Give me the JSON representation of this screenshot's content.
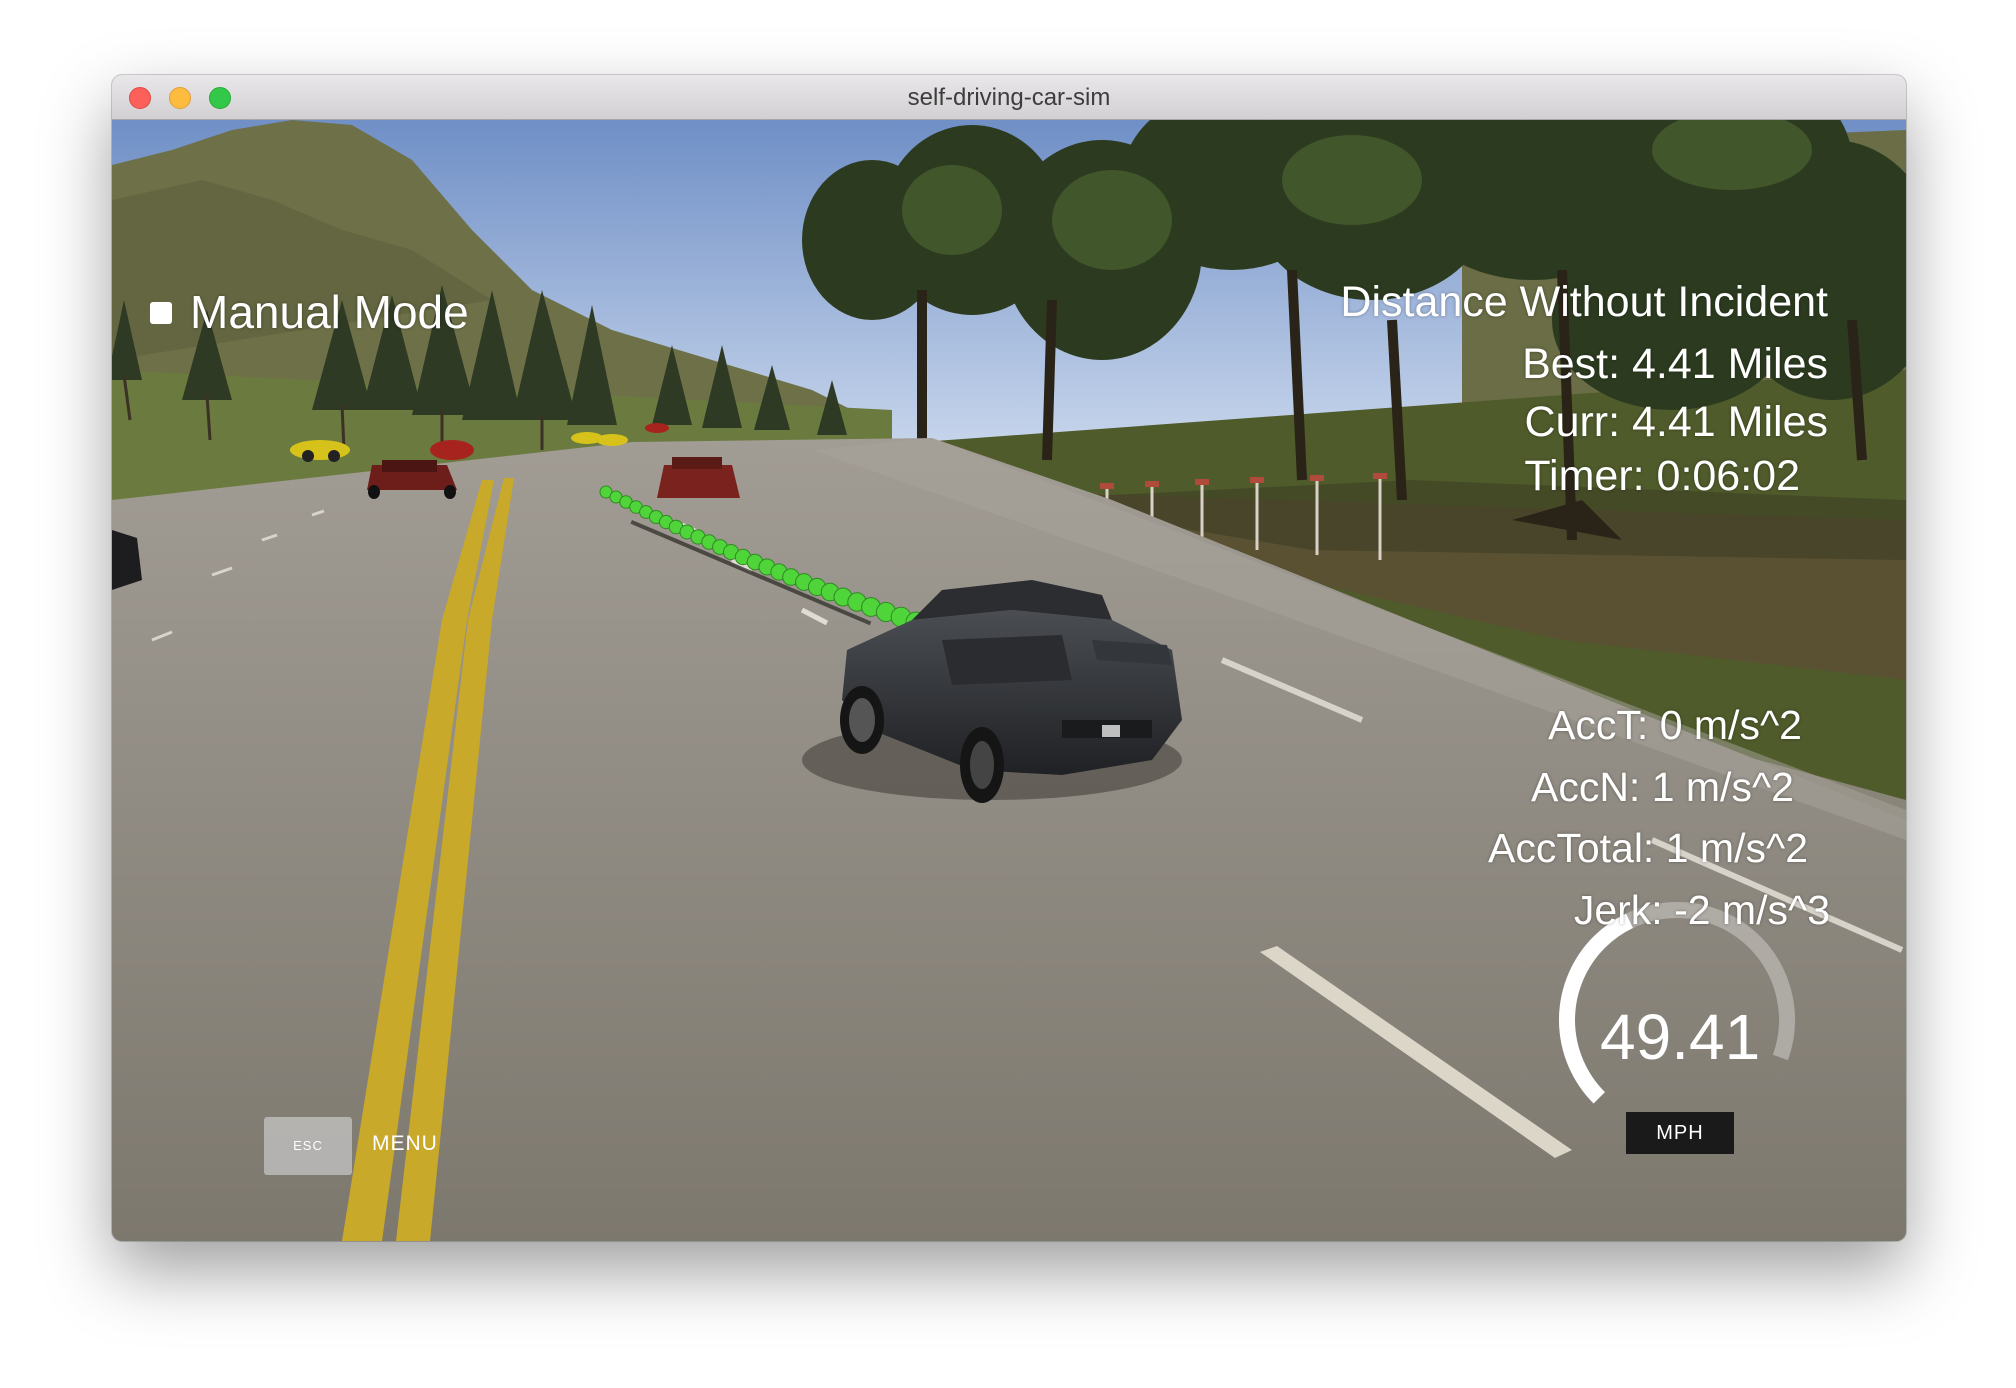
{
  "window": {
    "title": "self-driving-car-sim"
  },
  "hud": {
    "mode_label": "Manual Mode",
    "distance_title": "Distance Without Incident",
    "best": "Best: 4.41 Miles",
    "curr": "Curr: 4.41 Miles",
    "timer": "Timer: 0:06:02",
    "acc_t": "AccT: 0 m/s^2",
    "acc_n": "AccN: 1 m/s^2",
    "acc_total": "AccTotal: 1 m/s^2",
    "jerk": "Jerk: -2 m/s^3"
  },
  "speedometer": {
    "value": "49.41",
    "unit": "MPH",
    "gauge_fill_fraction": 0.45
  },
  "controls": {
    "esc_key": "ESC",
    "menu_label": "MENU"
  },
  "colors": {
    "path_dots": "#4fd43a",
    "lane_yellow": "#c9a92a",
    "road": "#8a8579",
    "grass": "#5e6a35"
  }
}
